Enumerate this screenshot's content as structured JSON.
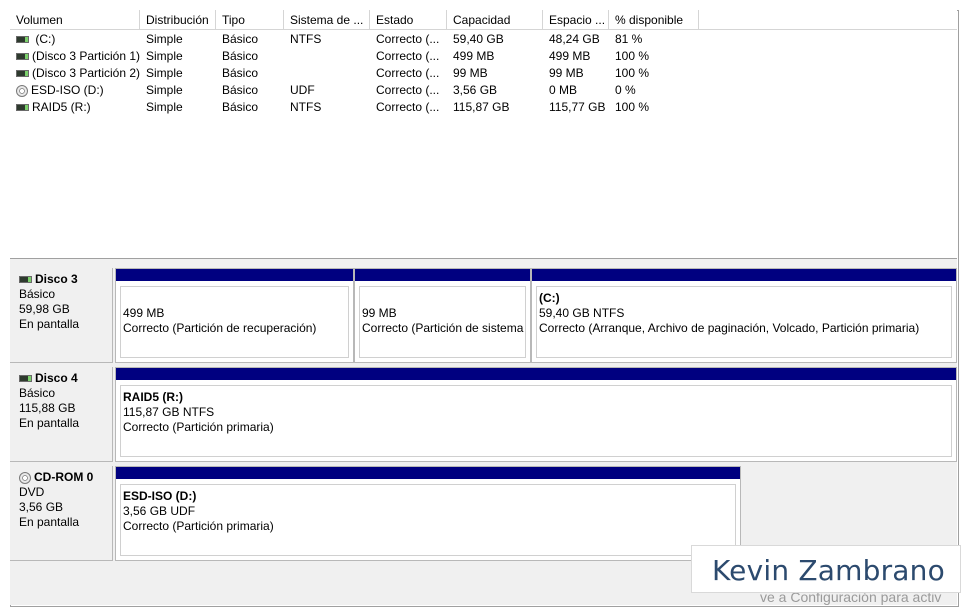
{
  "columns": [
    "Volumen",
    "Distribución",
    "Tipo",
    "Sistema de ...",
    "Estado",
    "Capacidad",
    "Espacio ...",
    "% disponible"
  ],
  "volumes": [
    {
      "icon": "hard-disk-icon",
      "volume": " (C:)",
      "layout": "Simple",
      "type": "Básico",
      "fs": "NTFS",
      "status": "Correcto (...",
      "capacity": "59,40 GB",
      "free": "48,24 GB",
      "pct": "81 %"
    },
    {
      "icon": "hard-disk-icon",
      "volume": "(Disco 3 Partición 1)",
      "layout": "Simple",
      "type": "Básico",
      "fs": "",
      "status": "Correcto (...",
      "capacity": "499 MB",
      "free": "499 MB",
      "pct": "100 %"
    },
    {
      "icon": "hard-disk-icon",
      "volume": "(Disco 3 Partición 2)",
      "layout": "Simple",
      "type": "Básico",
      "fs": "",
      "status": "Correcto (...",
      "capacity": "99 MB",
      "free": "99 MB",
      "pct": "100 %"
    },
    {
      "icon": "cd-disc-icon",
      "volume": "ESD-ISO (D:)",
      "layout": "Simple",
      "type": "Básico",
      "fs": "UDF",
      "status": "Correcto (...",
      "capacity": "3,56 GB",
      "free": "0 MB",
      "pct": "0 %"
    },
    {
      "icon": "hard-disk-icon",
      "volume": "RAID5 (R:)",
      "layout": "Simple",
      "type": "Básico",
      "fs": "NTFS",
      "status": "Correcto (...",
      "capacity": "115,87 GB",
      "free": "115,77 GB",
      "pct": "100 %"
    }
  ],
  "disks": [
    {
      "icon": "hard-disk-icon",
      "name": "Disco 3",
      "kind": "Básico",
      "size": "59,98 GB",
      "state": "En pantalla",
      "partitions": [
        {
          "title": "",
          "size": "499 MB",
          "status": "Correcto (Partición de recuperación)"
        },
        {
          "title": "",
          "size": "99 MB",
          "status": "Correcto (Partición de sistema"
        },
        {
          "title": "(C:)",
          "size": "59,40 GB NTFS",
          "status": "Correcto (Arranque, Archivo de paginación, Volcado, Partición primaria)"
        }
      ]
    },
    {
      "icon": "hard-disk-icon",
      "name": "Disco 4",
      "kind": "Básico",
      "size": "115,88 GB",
      "state": "En pantalla",
      "partitions": [
        {
          "title": "RAID5  (R:)",
          "size": "115,87 GB NTFS",
          "status": "Correcto (Partición primaria)"
        }
      ]
    },
    {
      "icon": "cd-disc-icon",
      "name": "CD-ROM 0",
      "kind": "DVD",
      "size": "3,56 GB",
      "state": "En pantalla",
      "partitions": [
        {
          "title": "ESD-ISO  (D:)",
          "size": "3,56 GB UDF",
          "status": "Correcto (Partición primaria)"
        }
      ]
    }
  ],
  "watermark": "Kevin Zambrano",
  "activate_text": "ve a Configuración para activ",
  "colors": {
    "partition_bar": "#000080",
    "watermark_text": "#2c4a6e"
  }
}
